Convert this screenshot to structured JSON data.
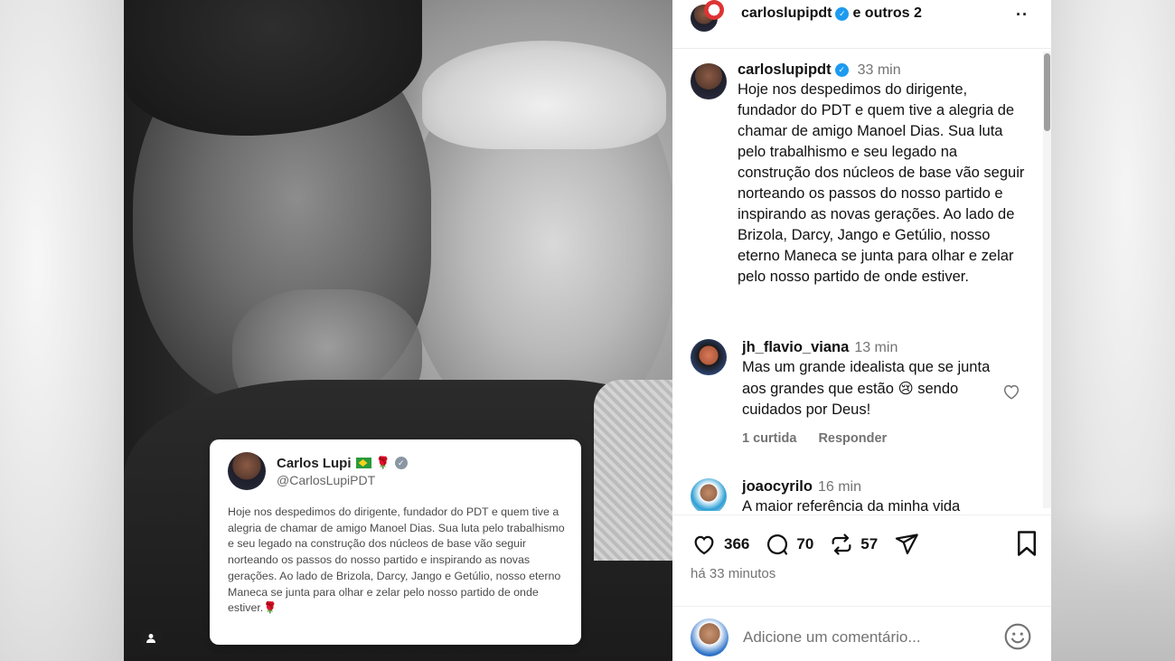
{
  "header": {
    "username": "carloslupipdt",
    "others": "e outros 2",
    "more": "··"
  },
  "tweet_card": {
    "name": "Carlos Lupi",
    "handle": "@CarlosLupiPDT",
    "text": "Hoje nos despedimos do dirigente, fundador do PDT e quem tive a alegria de chamar de amigo Manoel Dias. Sua luta pelo trabalhismo e seu legado na construção dos núcleos de base vão seguir norteando os passos do nosso partido e inspirando as novas gerações. Ao lado de Brizola, Darcy, Jango e Getúlio, nosso eterno Maneca se junta para olhar e zelar pelo nosso partido de onde estiver.",
    "rose": "🌹"
  },
  "caption": {
    "username": "carloslupipdt",
    "time": "33 min",
    "text": "Hoje nos despedimos do dirigente, fundador do PDT e quem tive a alegria de chamar de amigo Manoel Dias. Sua luta pelo trabalhismo e seu legado na construção dos núcleos de base vão seguir norteando os passos do nosso partido e inspirando as novas gerações. Ao lado de Brizola, Darcy, Jango e Getúlio, nosso eterno Maneca se junta para olhar e zelar pelo nosso partido de onde estiver."
  },
  "comments": [
    {
      "username": "jh_flavio_viana",
      "time": "13 min",
      "text": "Mas um grande idealista que se junta aos grandes que estão 😢 sendo cuidados por Deus!",
      "likes": "1 curtida",
      "reply": "Responder"
    },
    {
      "username": "joaocyrilo",
      "time": "16 min",
      "text": "A maior referência da minha vida"
    }
  ],
  "actions": {
    "likes": "366",
    "comments": "70",
    "reposts": "57",
    "posted_ago": "há 33 minutos"
  },
  "comment_input": {
    "placeholder": "Adicione um comentário..."
  },
  "colors": {
    "verified": "#1d9bf0",
    "muted_text": "#737373"
  },
  "icons": [
    "heart-icon",
    "comment-icon",
    "repost-icon",
    "share-icon",
    "bookmark-icon",
    "emoji-icon",
    "more-icon",
    "user-tag-icon"
  ]
}
